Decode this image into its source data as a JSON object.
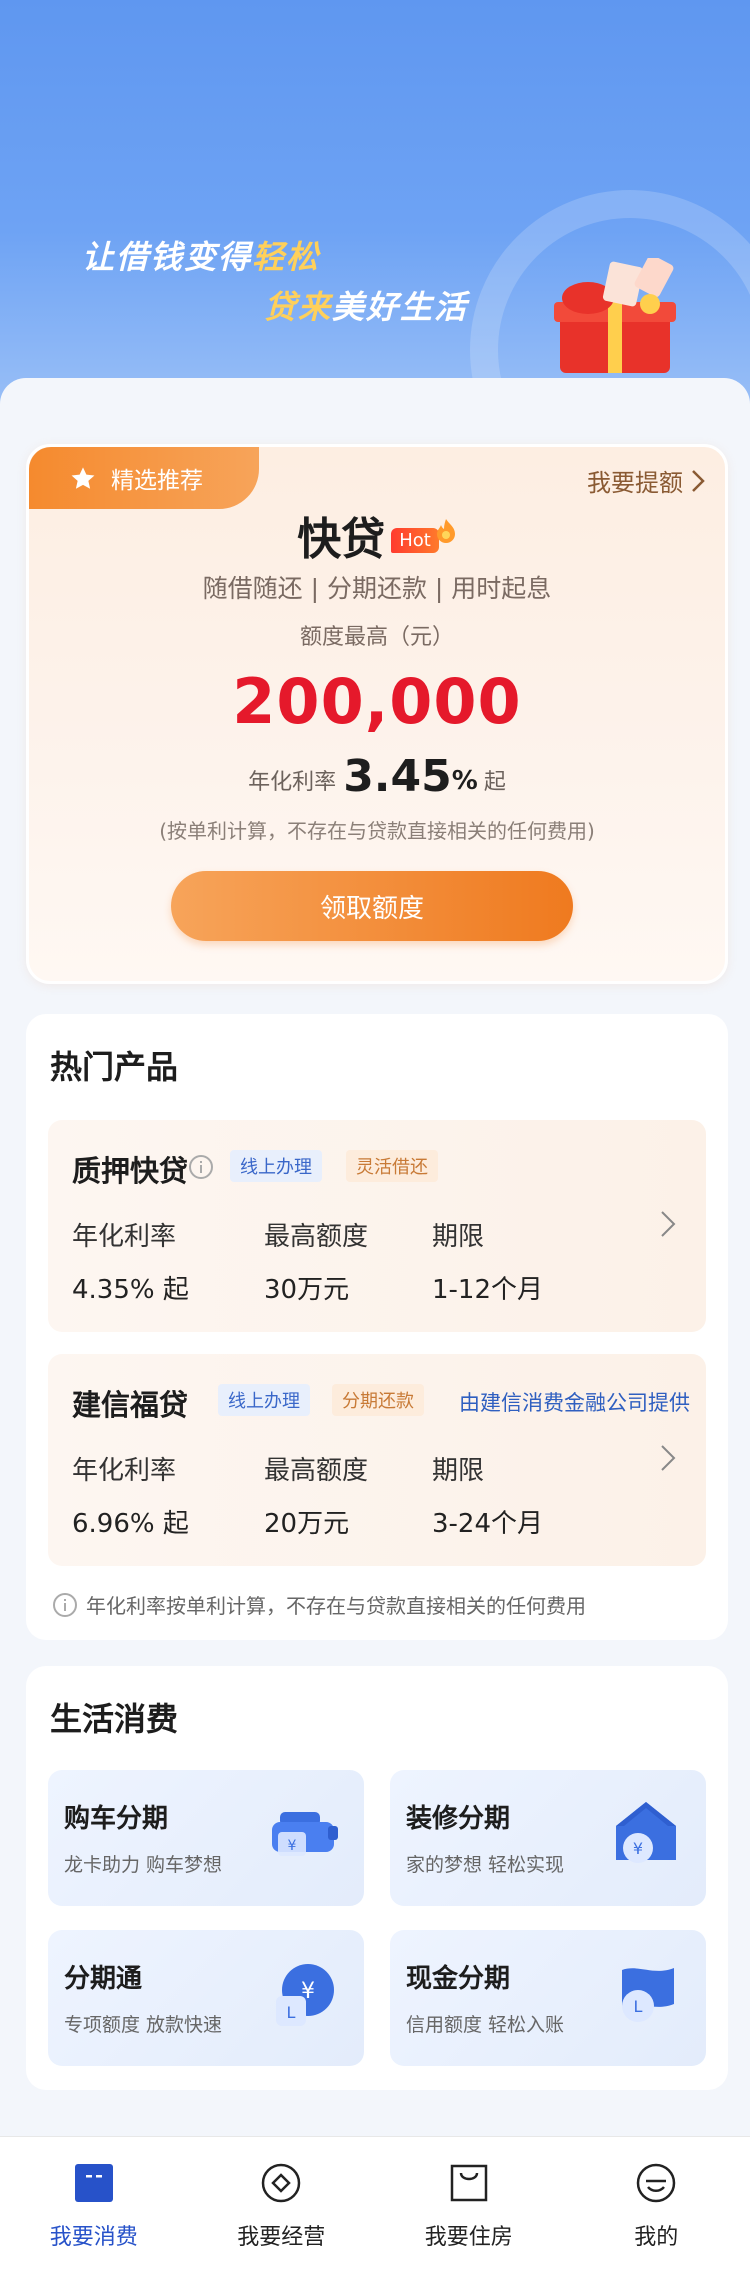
{
  "hero": {
    "slogan_line1_a": "让借钱变得",
    "slogan_line1_b": "轻松",
    "slogan_line2_a": "贷来",
    "slogan_line2_b": "美好生活"
  },
  "recommend": {
    "tag_label": "精选推荐",
    "quota_link": "我要提额",
    "product_name": "快贷",
    "hot_badge": "Hot",
    "features": "随借随还 | 分期还款 | 用时起息",
    "quota_label": "额度最高（元）",
    "quota_amount": "200,000",
    "rate_prefix": "年化利率",
    "rate_value": "3.45",
    "rate_unit": "%",
    "rate_suffix": "起",
    "note": "(按单利计算，不存在与贷款直接相关的任何费用)",
    "cta_label": "领取额度"
  },
  "hot_products": {
    "title": "热门产品",
    "items": [
      {
        "name": "质押快贷",
        "tags": [
          "线上办理",
          "灵活借还"
        ],
        "provider": "",
        "col1_label": "年化利率",
        "col1_value": "4.35% 起",
        "col2_label": "最高额度",
        "col2_value": "30万元",
        "col3_label": "期限",
        "col3_value": "1-12个月"
      },
      {
        "name": "建信福贷",
        "tags": [
          "线上办理",
          "分期还款"
        ],
        "provider": "由建信消费金融公司提供",
        "col1_label": "年化利率",
        "col1_value": "6.96% 起",
        "col2_label": "最高额度",
        "col2_value": "20万元",
        "col3_label": "期限",
        "col3_value": "3-24个月"
      }
    ],
    "disclaimer": "年化利率按单利计算，不存在与贷款直接相关的任何费用"
  },
  "life": {
    "title": "生活消费",
    "tiles": [
      {
        "title": "购车分期",
        "sub": "龙卡助力 购车梦想",
        "icon": "car-icon"
      },
      {
        "title": "装修分期",
        "sub": "家的梦想 轻松实现",
        "icon": "house-icon"
      },
      {
        "title": "分期通",
        "sub": "专项额度 放款快速",
        "icon": "yuan-coin-icon"
      },
      {
        "title": "现金分期",
        "sub": "信用额度 轻松入账",
        "icon": "cash-flag-icon"
      }
    ]
  },
  "nav": {
    "items": [
      {
        "label": "我要消费",
        "active": true
      },
      {
        "label": "我要经营",
        "active": false
      },
      {
        "label": "我要住房",
        "active": false
      },
      {
        "label": "我的",
        "active": false
      }
    ]
  },
  "colors": {
    "accent_orange": "#ef7a1f",
    "amount_red": "#e5192b",
    "nav_active_blue": "#2752c9",
    "hero_blue": "#5f97f0"
  }
}
